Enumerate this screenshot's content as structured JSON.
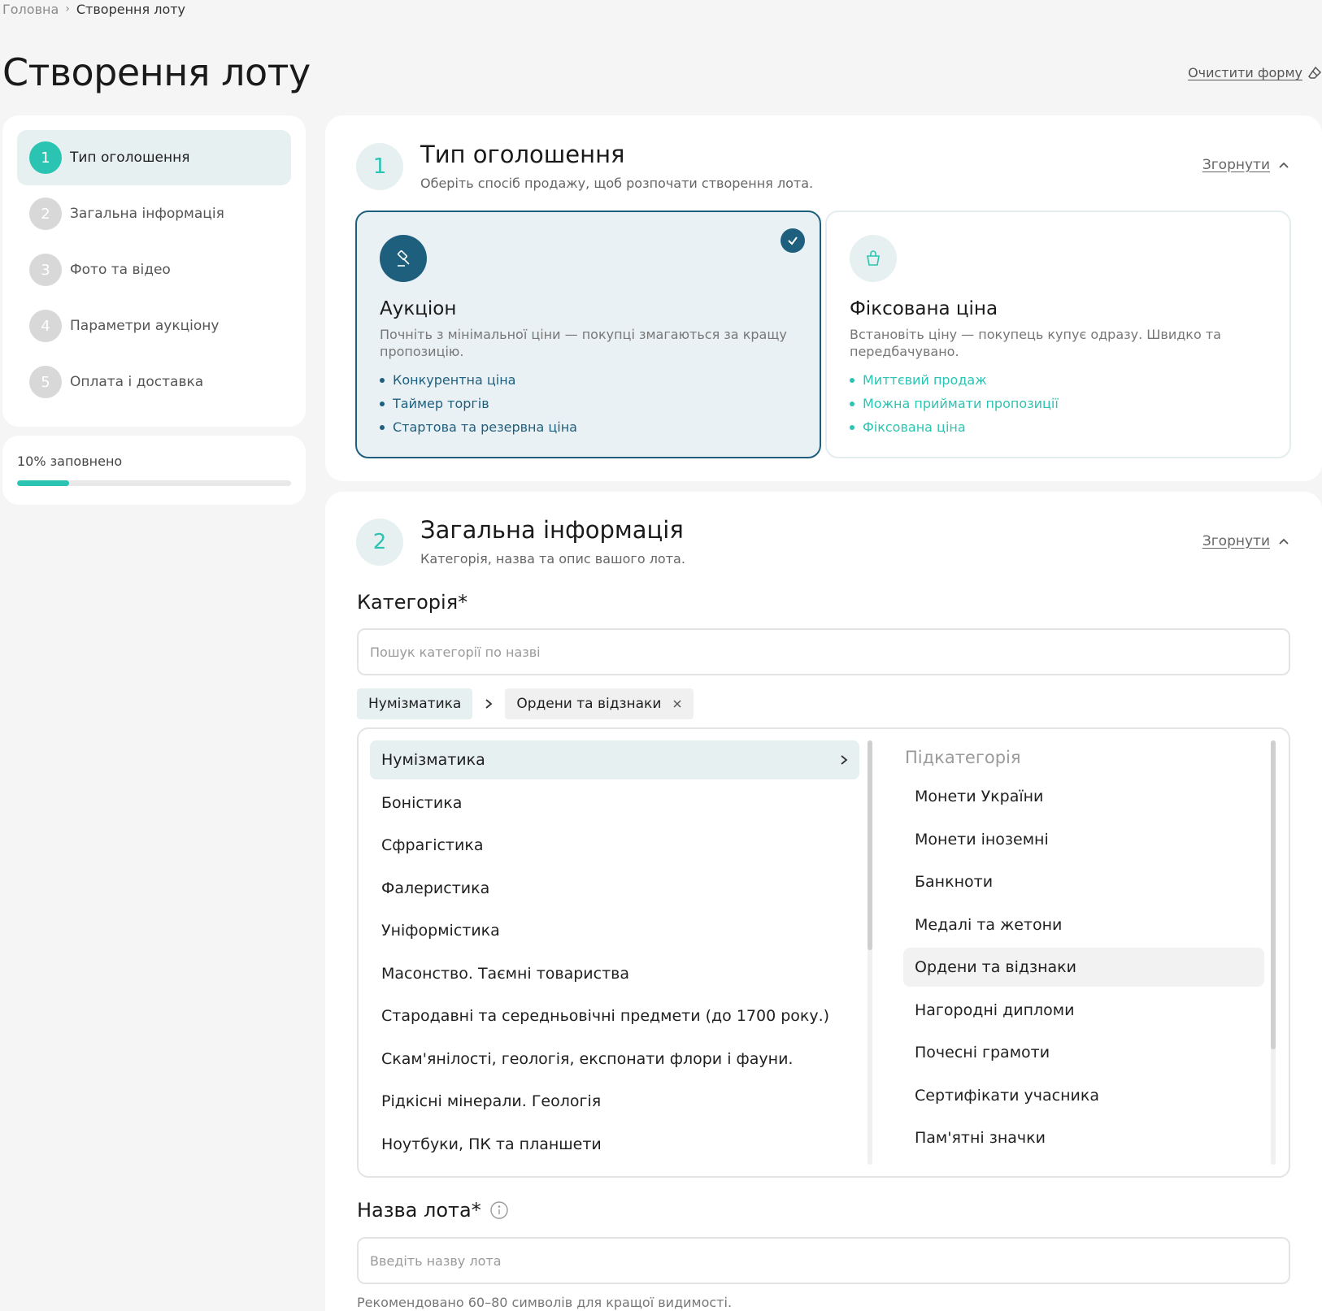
{
  "breadcrumb": {
    "home": "Головна",
    "current": "Створення лоту"
  },
  "page": {
    "title": "Створення лоту",
    "clear_form": "Очистити форму"
  },
  "steps": [
    {
      "num": "1",
      "label": "Тип оголошення"
    },
    {
      "num": "2",
      "label": "Загальна інформація"
    },
    {
      "num": "3",
      "label": "Фото та відео"
    },
    {
      "num": "4",
      "label": "Параметри аукціону"
    },
    {
      "num": "5",
      "label": "Оплата і доставка"
    }
  ],
  "progress": {
    "text": "10% заповнено",
    "fraction": 0.1
  },
  "section1": {
    "num": "1",
    "title": "Тип оголошення",
    "subtitle": "Оберіть спосіб продажу, щоб розпочати створення лота.",
    "collapse": "Згорнути",
    "auction": {
      "title": "Аукціон",
      "desc": "Почніть з мінімальної ціни — покупці змагаються за кращу пропозицію.",
      "features": [
        "Конкурентна ціна",
        "Таймер торгів",
        "Стартова та резервна ціна"
      ]
    },
    "fixed": {
      "title": "Фіксована ціна",
      "desc": "Встановіть ціну — покупець купує одразу. Швидко та передбачувано.",
      "features": [
        "Миттєвий продаж",
        "Можна приймати пропозиції",
        "Фіксована ціна"
      ]
    }
  },
  "section2": {
    "num": "2",
    "title": "Загальна інформація",
    "subtitle": "Категорія, назва та опис вашого лота.",
    "collapse": "Згорнути",
    "category_label": "Категорія*",
    "category_search_placeholder": "Пошук категорії по назві",
    "chips": [
      "Нумізматика",
      "Ордени та відзнаки"
    ],
    "categories": [
      "Нумізматика",
      "Боністика",
      "Сфрагістика",
      "Фалеристика",
      "Уніформістика",
      "Масонство. Таємні товариства",
      "Стародавні та середньовічні предмети (до 1700 року.)",
      "Скам'янілості, геологія, експонати флори і фауни.",
      "Рідкісні мінерали. Геологія",
      "Ноутбуки, ПК та планшети"
    ],
    "subcategory_heading": "Підкатегорія",
    "subcategories": [
      "Монети України",
      "Монети іноземні",
      "Банкноти",
      "Медалі та жетони",
      "Ордени та відзнаки",
      "Нагородні дипломи",
      "Почесні грамоти",
      "Сертифікати учасника",
      "Пам'ятні значки"
    ],
    "lot_name_label": "Назва лота*",
    "lot_name_placeholder": "Введіть назву лота",
    "lot_name_hint": "Рекомендовано 60–80 символів для кращої видимості."
  },
  "colors": {
    "accent": "#2bc4b3",
    "primary_dark": "#1e5f7e",
    "active_bg": "#e6f0f0"
  },
  "icons": {
    "clear": "eraser-icon",
    "auction": "gavel-icon",
    "fixed": "shopping-bag-icon",
    "selected": "check-icon",
    "info": "info-icon"
  }
}
